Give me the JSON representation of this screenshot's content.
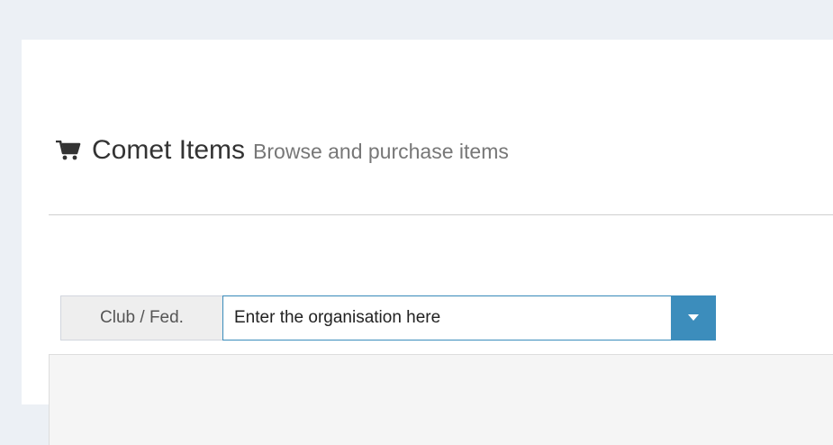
{
  "header": {
    "title": "Comet Items",
    "subtitle": "Browse and purchase items",
    "icon": "shopping-cart-icon"
  },
  "org_selector": {
    "label": "Club / Fed.",
    "value": "Enter the organisation here",
    "dropdown_icon": "caret-down-icon"
  },
  "colors": {
    "accent": "#3c8dbc",
    "page_background": "#ecf0f5",
    "title_text": "#333333",
    "subtitle_text": "#777777"
  }
}
